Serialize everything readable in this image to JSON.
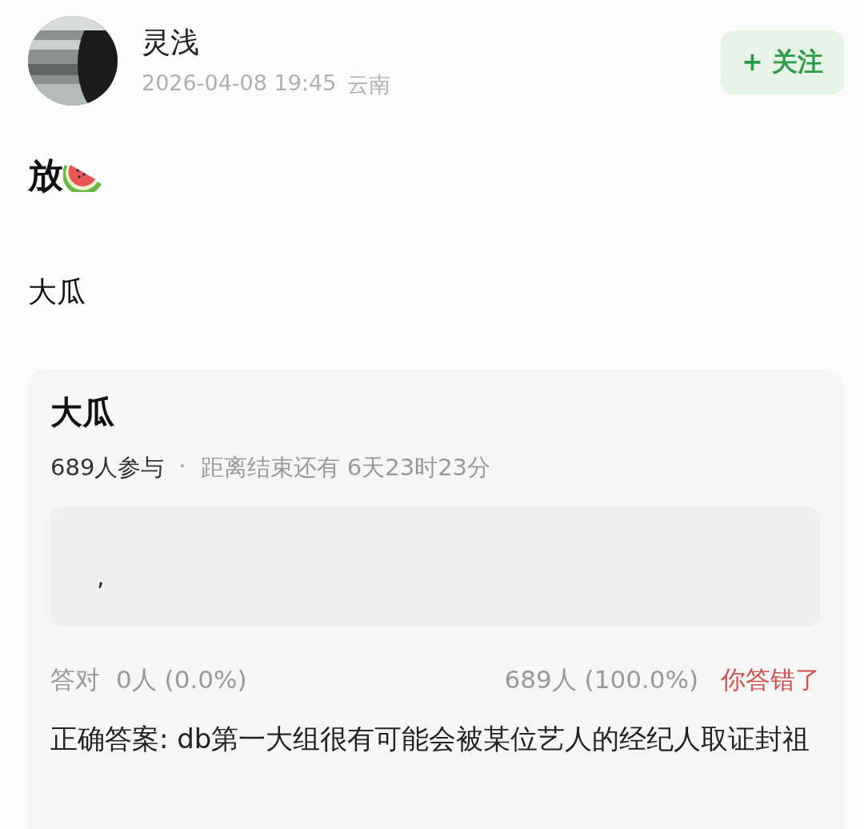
{
  "author": {
    "name": "灵浅",
    "time": "2026-04-08 19:45",
    "location": "云南"
  },
  "follow_button": {
    "label": "+ 关注",
    "following": false
  },
  "post": {
    "lines": [
      "放",
      "大瓜"
    ]
  },
  "quiz": {
    "title": "大瓜",
    "participants": "689人参与",
    "separator": "·",
    "remaining": "距离结束还有 6天23时23分",
    "options": [
      {
        "text": ","
      }
    ],
    "correct_label": "答对",
    "correct_count": "0人 (0.0%)",
    "wrong_count": "689人 (100.0%)",
    "verdict": "你答错了",
    "user_correct": false,
    "answer": "正确答案: db第一大组很有可能会被某位艺人的经纪人取证封祖"
  }
}
